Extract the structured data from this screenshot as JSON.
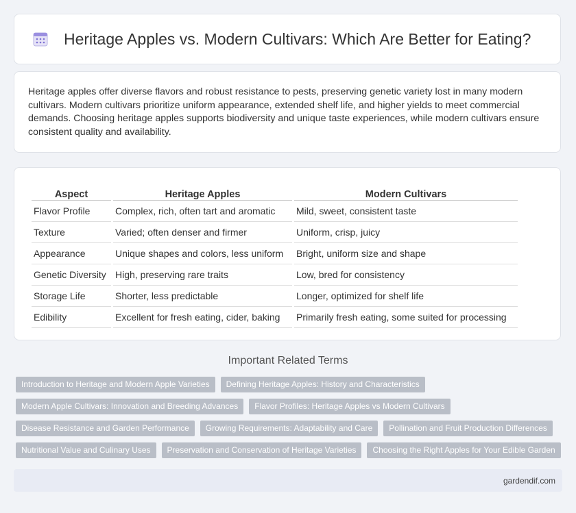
{
  "header": {
    "title": "Heritage Apples vs. Modern Cultivars: Which Are Better for Eating?",
    "icon": "calendar-icon"
  },
  "intro": {
    "text": "Heritage apples offer diverse flavors and robust resistance to pests, preserving genetic variety lost in many modern cultivars. Modern cultivars prioritize uniform appearance, extended shelf life, and higher yields to meet commercial demands. Choosing heritage apples supports biodiversity and unique taste experiences, while modern cultivars ensure consistent quality and availability."
  },
  "table": {
    "headers": [
      "Aspect",
      "Heritage Apples",
      "Modern Cultivars"
    ],
    "rows": [
      [
        "Flavor Profile",
        "Complex, rich, often tart and aromatic",
        "Mild, sweet, consistent taste"
      ],
      [
        "Texture",
        "Varied; often denser and firmer",
        "Uniform, crisp, juicy"
      ],
      [
        "Appearance",
        "Unique shapes and colors, less uniform",
        "Bright, uniform size and shape"
      ],
      [
        "Genetic Diversity",
        "High, preserving rare traits",
        "Low, bred for consistency"
      ],
      [
        "Storage Life",
        "Shorter, less predictable",
        "Longer, optimized for shelf life"
      ],
      [
        "Edibility",
        "Excellent for fresh eating, cider, baking",
        "Primarily fresh eating, some suited for processing"
      ]
    ]
  },
  "related": {
    "title": "Important Related Terms",
    "rows": [
      [
        "Introduction to Heritage and Modern Apple Varieties",
        "Defining Heritage Apples: History and Characteristics"
      ],
      [
        "Modern Apple Cultivars: Innovation and Breeding Advances",
        "Flavor Profiles: Heritage Apples vs Modern Cultivars"
      ],
      [
        "Disease Resistance and Garden Performance",
        "Growing Requirements: Adaptability and Care",
        "Pollination and Fruit Production Differences"
      ],
      [
        "Nutritional Value and Culinary Uses",
        "Preservation and Conservation of Heritage Varieties",
        "Choosing the Right Apples for Your Edible Garden"
      ]
    ]
  },
  "footer": {
    "site": "gardendif.com"
  },
  "colors": {
    "background": "#f1f3f7",
    "card": "#ffffff",
    "tag": "#b9bec7",
    "footer": "#e8ebf4"
  }
}
